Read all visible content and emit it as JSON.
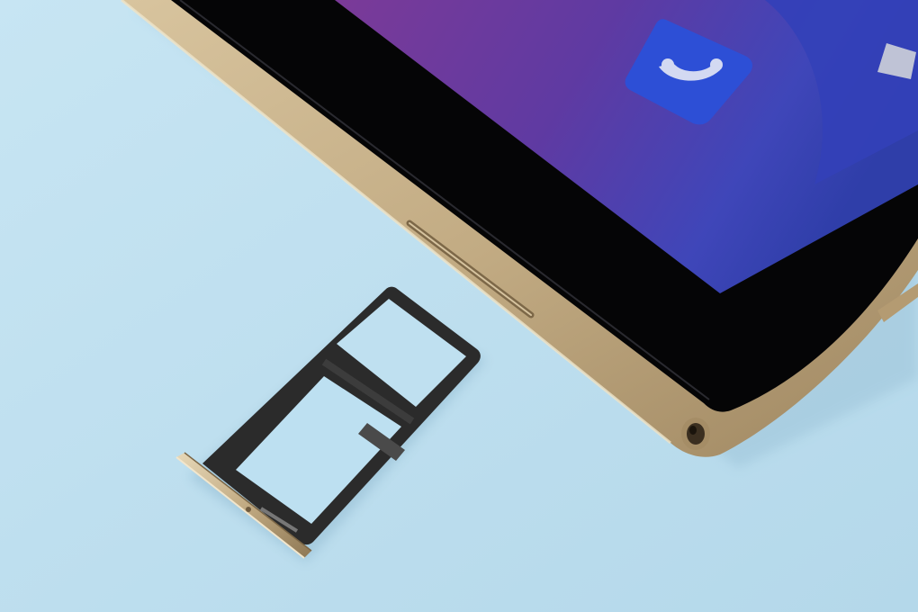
{
  "scene": {
    "subject": "tablet-and-sim-tray",
    "colors": {
      "background": "#bfe0f0",
      "background_shadow": "#a9d0e4",
      "tablet_frame": "#c2ab83",
      "tablet_frame_highlight": "#e4d4b4",
      "tablet_frame_shadow": "#8f7a58",
      "bezel": "#050506",
      "screen_purple": "#6a3a9e",
      "screen_blue": "#3c3fb8",
      "phone_icon_bg": "#2d4fd6",
      "phone_icon_glyph": "#cfd6f0",
      "tray_metal": "#2b2b2b",
      "tray_gold": "#b9a27a"
    },
    "icons": [
      "phone-icon",
      "app-icon"
    ]
  }
}
